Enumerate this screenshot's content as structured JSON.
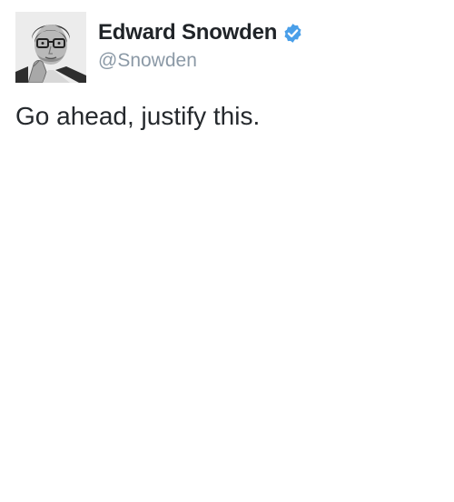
{
  "tweet": {
    "author": {
      "display_name": "Edward Snowden",
      "handle": "@Snowden",
      "verified": true,
      "avatar_icon": "profile-photo",
      "verified_icon": "verified-badge-icon",
      "verified_color": "#4a9fe9"
    },
    "text": "Go ahead, justify this."
  }
}
